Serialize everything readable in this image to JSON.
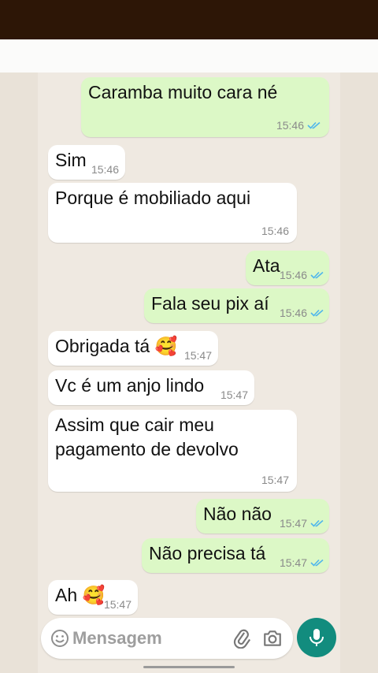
{
  "messages": [
    {
      "text": "Caramba muito cara né",
      "time": "15:46",
      "direction": "out",
      "read": true
    },
    {
      "text": "Sim",
      "time": "15:46",
      "direction": "in"
    },
    {
      "text": "Porque é mobiliado aqui",
      "time": "15:46",
      "direction": "in"
    },
    {
      "text": "Ata",
      "time": "15:46",
      "direction": "out",
      "read": true
    },
    {
      "text": "Fala seu pix aí",
      "time": "15:46",
      "direction": "out",
      "read": true
    },
    {
      "text": "Obrigada tá 🥰",
      "time": "15:47",
      "direction": "in"
    },
    {
      "text": "Vc é um anjo lindo",
      "time": "15:47",
      "direction": "in"
    },
    {
      "text": "Assim que cair meu",
      "text2": "pagamento de devolvo",
      "time": "15:47",
      "direction": "in"
    },
    {
      "text": "Não não",
      "time": "15:47",
      "direction": "out",
      "read": true
    },
    {
      "text": "Não precisa tá",
      "time": "15:47",
      "direction": "out",
      "read": true
    },
    {
      "text": "Ah 🥰",
      "time": "15:47",
      "direction": "in"
    }
  ],
  "composer": {
    "placeholder": "Mensagem"
  },
  "icons": {
    "emoji": "emoji-icon",
    "attach": "paperclip-icon",
    "camera": "camera-icon",
    "mic": "microphone-icon",
    "read_receipt": "double-check-icon"
  },
  "colors": {
    "incoming": "#ffffff",
    "outgoing": "#dcf8c6",
    "read_ticks": "#4fb6ec",
    "mic_button": "#128c7e",
    "top_bar": "#2d1606"
  }
}
